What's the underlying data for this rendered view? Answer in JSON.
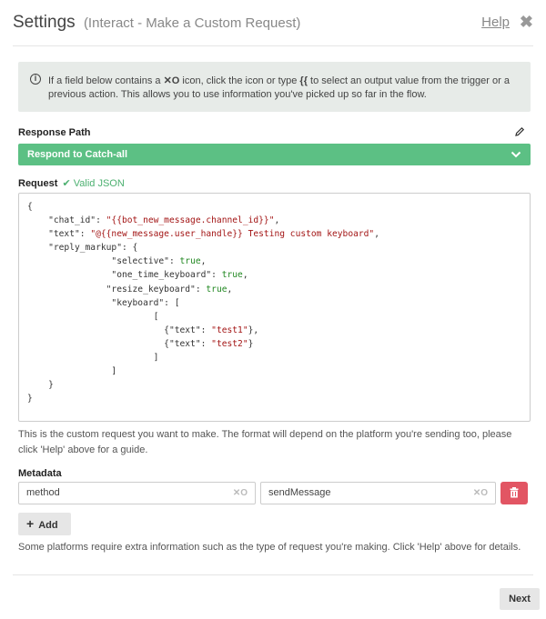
{
  "header": {
    "title": "Settings",
    "subtitle": "(Interact - Make a Custom Request)",
    "help_label": "Help",
    "close_glyph": "✖"
  },
  "info": {
    "before_icon": "If a field below contains a ",
    "icon_glyph": "✕O",
    "middle": " icon, click the icon or type ",
    "braces": "{{",
    "after": " to select an output value from the trigger or a previous action. This allows you to use information you've picked up so far in the flow."
  },
  "response_path": {
    "label": "Response Path",
    "selected": "Respond to Catch-all"
  },
  "request": {
    "label": "Request",
    "valid_label": "Valid JSON",
    "lines": [
      [
        {
          "t": "{"
        }
      ],
      [
        {
          "t": "    \"chat_id\": "
        },
        {
          "t": "\"{{bot_new_message.channel_id}}\"",
          "c": "str"
        },
        {
          "t": ","
        }
      ],
      [
        {
          "t": "    \"text\": "
        },
        {
          "t": "\"@{{new_message.user_handle}} Testing custom keyboard\"",
          "c": "str"
        },
        {
          "t": ","
        }
      ],
      [
        {
          "t": "    \"reply_markup\": {"
        }
      ],
      [
        {
          "t": "                \"selective\": "
        },
        {
          "t": "true",
          "c": "kw"
        },
        {
          "t": ","
        }
      ],
      [
        {
          "t": "                \"one_time_keyboard\": "
        },
        {
          "t": "true",
          "c": "kw"
        },
        {
          "t": ","
        }
      ],
      [
        {
          "t": "               \"resize_keyboard\": "
        },
        {
          "t": "true",
          "c": "kw"
        },
        {
          "t": ","
        }
      ],
      [
        {
          "t": "                \"keyboard\": ["
        }
      ],
      [
        {
          "t": "                        ["
        }
      ],
      [
        {
          "t": "                          {\"text\": "
        },
        {
          "t": "\"test1\"",
          "c": "str"
        },
        {
          "t": "},"
        }
      ],
      [
        {
          "t": "                          {\"text\": "
        },
        {
          "t": "\"test2\"",
          "c": "str"
        },
        {
          "t": "}"
        }
      ],
      [
        {
          "t": "                        ]"
        }
      ],
      [
        {
          "t": "                ]"
        }
      ],
      [
        {
          "t": "    }"
        }
      ],
      [
        {
          "t": "}"
        }
      ]
    ],
    "help_text": "This is the custom request you want to make. The format will depend on the platform you're sending too, please click 'Help' above for a guide."
  },
  "metadata": {
    "label": "Metadata",
    "key_value": "method",
    "value_value": "sendMessage",
    "xo_glyph": "✕O",
    "add_label": "Add",
    "note": "Some platforms require extra information such as the type of request you're making. Click 'Help' above for details."
  },
  "footer": {
    "next_label": "Next"
  },
  "colors": {
    "accent_green": "#5cc084",
    "valid_green": "#4cb070",
    "delete_red": "#e25563",
    "string_red": "#a31515",
    "keyword_green": "#228822"
  }
}
